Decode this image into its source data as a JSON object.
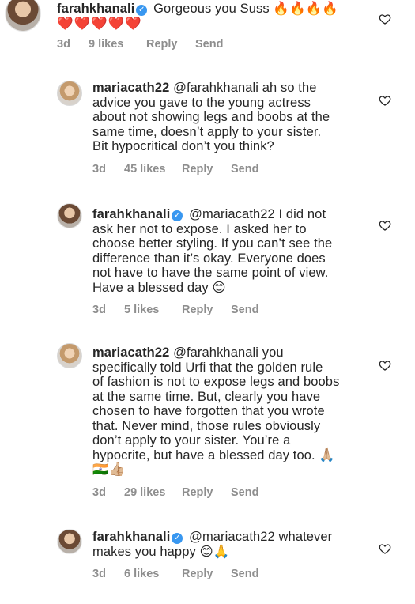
{
  "comments": [
    {
      "username": "farahkhanali",
      "verified": true,
      "lines": [
        " Gorgeous you Suss 🔥🔥🔥🔥",
        "❤️❤️❤️❤️❤️"
      ],
      "meta": {
        "date": "3d",
        "likes": "9 likes",
        "reply": "Reply",
        "send": "Send"
      }
    },
    {
      "username": "mariacath22",
      "verified": false,
      "lines": [
        " @farahkhanali ah so the",
        "advice you gave to the young actress",
        "about not showing legs and boobs at the",
        "same time, doesn’t apply to your sister.",
        "Bit hypocritical don’t you think?"
      ],
      "meta": {
        "date": "3d",
        "likes": "45 likes",
        "reply": "Reply",
        "send": "Send"
      }
    },
    {
      "username": "farahkhanali",
      "verified": true,
      "lines": [
        " @mariacath22 I did not",
        "ask her not to expose. I asked her to",
        "choose better styling. If you can’t see the",
        "difference than it’s okay. Everyone does",
        "not have to have the same point of view.",
        "Have a blessed day 😊"
      ],
      "meta": {
        "date": "3d",
        "likes": "5 likes",
        "reply": "Reply",
        "send": "Send"
      }
    },
    {
      "username": "mariacath22",
      "verified": false,
      "lines": [
        " @farahkhanali you",
        "specifically told Urfi that the golden rule",
        "of fashion is not to expose legs and boobs",
        "at the same time. But, clearly you have",
        "chosen to have forgotten that you wrote",
        "that. Never mind, those rules obviously",
        "don’t apply to your sister. You’re a",
        "hypocrite, but have a blessed day too. 🙏🏼",
        "🇮🇳👍🏼"
      ],
      "meta": {
        "date": "3d",
        "likes": "29 likes",
        "reply": "Reply",
        "send": "Send"
      }
    },
    {
      "username": "farahkhanali",
      "verified": true,
      "lines": [
        " @mariacath22 whatever",
        "makes you happy 😊🙏"
      ],
      "meta": {
        "date": "3d",
        "likes": "6 likes",
        "reply": "Reply",
        "send": "Send"
      }
    }
  ],
  "icons": {
    "like": "heart-outline-icon",
    "verified": "verified-badge-icon"
  }
}
